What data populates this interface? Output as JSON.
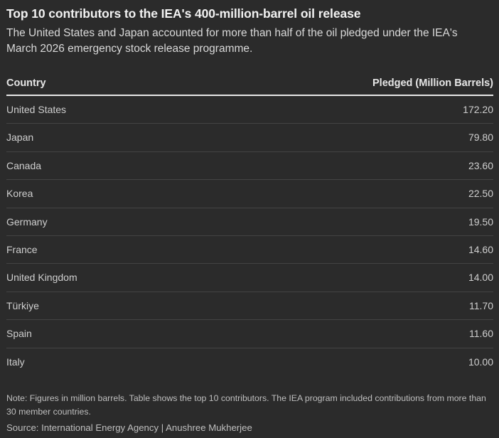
{
  "title": "Top 10 contributors to the IEA's 400-million-barrel oil release",
  "subtitle": "The United States and Japan accounted for more than half of the oil pledged under the IEA's March 2026 emergency stock release programme.",
  "colors": {
    "background": "#2b2b2b",
    "text": "#d9d9d9",
    "header_rule": "#e6e6e6",
    "row_divider": "#444444"
  },
  "chart_data": {
    "type": "table",
    "title": "Top 10 contributors to the IEA's 400-million-barrel oil release",
    "subtitle": "The United States and Japan accounted for more than half of the oil pledged under the IEA's March 2026 emergency stock release programme.",
    "columns": [
      "Country",
      "Pledged (Million Barrels)"
    ],
    "rows": [
      {
        "country": "United States",
        "value": "172.20"
      },
      {
        "country": "Japan",
        "value": "79.80"
      },
      {
        "country": "Canada",
        "value": "23.60"
      },
      {
        "country": "Korea",
        "value": "22.50"
      },
      {
        "country": "Germany",
        "value": "19.50"
      },
      {
        "country": "France",
        "value": "14.60"
      },
      {
        "country": "United Kingdom",
        "value": "14.00"
      },
      {
        "country": "Türkiye",
        "value": "11.70"
      },
      {
        "country": "Spain",
        "value": "11.60"
      },
      {
        "country": "Italy",
        "value": "10.00"
      }
    ]
  },
  "note": "Note: Figures in million barrels. Table shows the top 10 contributors. The IEA program included contributions from more than 30 member countries.",
  "source": "Source: International Energy Agency | Anushree Mukherjee"
}
